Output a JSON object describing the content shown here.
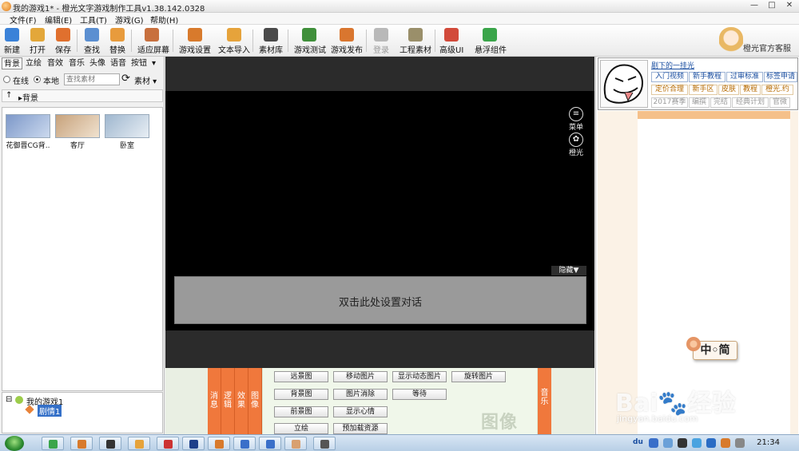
{
  "window": {
    "title": "我的游戏1* - 橙光文字游戏制作工具v1.38.142.0328",
    "min": "—",
    "max": "□",
    "close": "✕"
  },
  "menu": [
    "文件(F)",
    "编辑(E)",
    "工具(T)",
    "游戏(G)",
    "帮助(H)"
  ],
  "toolbar": {
    "items": [
      {
        "label": "新建",
        "name": "new-button",
        "color": "#3b82d8",
        "disabled": false
      },
      {
        "label": "打开",
        "name": "open-button",
        "color": "#e3a73a",
        "disabled": false
      },
      {
        "label": "保存",
        "name": "save-button",
        "color": "#e0702e",
        "disabled": false
      },
      {
        "label": "查找",
        "name": "find-button",
        "color": "#5b8fd1",
        "disabled": false
      },
      {
        "label": "替换",
        "name": "replace-button",
        "color": "#e89b3c",
        "disabled": false
      },
      {
        "label": "适应屏幕",
        "name": "fit-screen-button",
        "color": "#c8703e",
        "disabled": false
      },
      {
        "label": "游戏设置",
        "name": "game-settings-button",
        "color": "#d87a2c",
        "disabled": false
      },
      {
        "label": "文本导入",
        "name": "text-import-button",
        "color": "#e6a33b",
        "disabled": false
      },
      {
        "label": "素材库",
        "name": "asset-library-button",
        "color": "#4a4a4a",
        "disabled": false
      },
      {
        "label": "游戏测试",
        "name": "game-test-button",
        "color": "#3f8f3a",
        "disabled": false
      },
      {
        "label": "游戏发布",
        "name": "game-publish-button",
        "color": "#d9762f",
        "disabled": false
      },
      {
        "label": "登录",
        "name": "login-button",
        "color": "#b9b9b9",
        "disabled": true
      },
      {
        "label": "工程素材",
        "name": "project-assets-button",
        "color": "#9a8f6a",
        "disabled": false
      },
      {
        "label": "高级UI",
        "name": "advanced-ui-button",
        "color": "#d24a3a",
        "disabled": false
      },
      {
        "label": "悬浮组件",
        "name": "floating-widget-button",
        "color": "#3aa54a",
        "disabled": false
      }
    ],
    "support_label": "橙光官方客服"
  },
  "left": {
    "tabs": [
      "背景",
      "立绘",
      "音效",
      "音乐",
      "头像",
      "语音",
      "按钮",
      "▾"
    ],
    "source_online": "在线",
    "source_local": "本地",
    "search_placeholder": "查找素材",
    "refresh_icon": "⟳",
    "asset_dropdown": "素材 ▾",
    "up_arrow": "↑",
    "path": "▸背景",
    "thumbs": [
      {
        "caption": "花御晋CG背..",
        "color_a": "#7d98c9",
        "color_b": "#cbd9ee"
      },
      {
        "caption": "客厅",
        "color_a": "#c7a27c",
        "color_b": "#f0e2cf"
      },
      {
        "caption": "卧室",
        "color_a": "#9fb7cf",
        "color_b": "#e8eef4"
      }
    ],
    "tree": {
      "toggle": "⊟",
      "root": "我的游戏1",
      "child": "剧情1"
    }
  },
  "stage": {
    "menu_icon_label": "菜单",
    "orange_icon_label": "橙光",
    "hide_label": "隐藏▼",
    "dialog_text": "双击此处设置对话"
  },
  "commands": {
    "tabs": [
      "消息",
      "逻辑",
      "效果",
      "图像"
    ],
    "buttons": [
      {
        "label": "远景图"
      },
      {
        "label": "移动图片"
      },
      {
        "label": "显示动态图片"
      },
      {
        "label": "旋转图片"
      },
      {
        "label": "背景图"
      },
      {
        "label": "图片消除"
      },
      {
        "label": "等待"
      },
      {
        "label": "前景图"
      },
      {
        "label": "显示心情"
      },
      {
        "label": "立绘"
      },
      {
        "label": "预加载资源"
      }
    ],
    "watermark": "图像",
    "music_tab": "音乐"
  },
  "right": {
    "news_title": "剧下的一挂光",
    "links": [
      {
        "label": "入门视频",
        "style": "b"
      },
      {
        "label": "新手教程",
        "style": "b"
      },
      {
        "label": "过审标准",
        "style": "b"
      },
      {
        "label": "标签申请",
        "style": "b"
      },
      {
        "label": "定价合理",
        "style": "o"
      },
      {
        "label": "新手区",
        "style": "o"
      },
      {
        "label": "皮肤",
        "style": "o"
      },
      {
        "label": "教程",
        "style": "o"
      },
      {
        "label": "橙光.约",
        "style": "o"
      },
      {
        "label": "2017赛季",
        "style": "g"
      },
      {
        "label": "编撰",
        "style": "g"
      },
      {
        "label": "完结",
        "style": "g"
      },
      {
        "label": "经典计划",
        "style": "g"
      },
      {
        "label": "官微",
        "style": "g"
      }
    ],
    "lang_label": "中◦简"
  },
  "watermark": {
    "brand": "Bai🐾经验",
    "url": "jingyan.baidu.com"
  },
  "taskbar": {
    "clock": "21:34",
    "tray_label": "du"
  }
}
